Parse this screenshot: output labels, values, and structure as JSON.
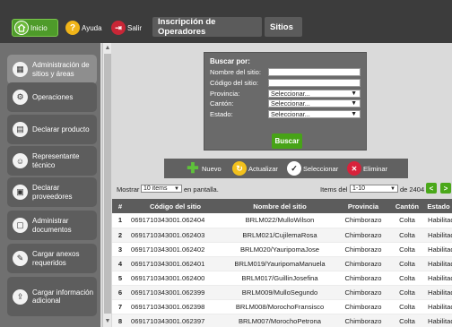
{
  "topbar": {
    "inicio_label": "Inicio",
    "ayuda_label": "Ayuda",
    "salir_label": "Salir",
    "tabs": [
      {
        "label": "Inscripción de Operadores"
      },
      {
        "label": "Sitios"
      }
    ],
    "accent": "#4e9b2a"
  },
  "sidebar": {
    "items": [
      {
        "label": "Administración de sitios y áreas",
        "icon": "building-icon"
      },
      {
        "label": "Operaciones",
        "icon": "gear-icon"
      },
      {
        "label": "Declarar producto",
        "icon": "truck-icon"
      },
      {
        "label": "Representante técnico",
        "icon": "person-icon"
      },
      {
        "label": "Declarar proveedores",
        "icon": "document-icon"
      },
      {
        "label": "Administrar documentos",
        "icon": "file-icon"
      },
      {
        "label": "Cargar anexos requeridos",
        "icon": "attachment-icon"
      },
      {
        "label": "Cargar información adicional",
        "icon": "upload-icon"
      }
    ]
  },
  "search": {
    "title": "Buscar por:",
    "fields": [
      {
        "label": "Nombre del sitio:",
        "value": ""
      },
      {
        "label": "Código del sitio:",
        "value": ""
      },
      {
        "label": "Provincia:",
        "value": "Seleccionar..."
      },
      {
        "label": "Cantón:",
        "value": "Seleccionar..."
      },
      {
        "label": "Estado:",
        "value": "Seleccionar..."
      }
    ],
    "button_label": "Buscar"
  },
  "toolbar": {
    "nuevo": "Nuevo",
    "actualizar": "Actualizar",
    "seleccionar": "Seleccionar",
    "eliminar": "Eliminar"
  },
  "pager": {
    "mostrar": "Mostrar",
    "items_per_page": "10 items",
    "en_pantalla": "en pantalla.",
    "items_del": "Items del",
    "range": "1-10",
    "of_total": "de 2404",
    "prev": "<",
    "next": ">"
  },
  "table": {
    "columns": [
      "#",
      "Código del sitio",
      "Nombre del sitio",
      "Provincia",
      "Cantón",
      "Estado"
    ],
    "rows": [
      [
        "1",
        "0691710343001.062404",
        "BRLM022/MulloWilson",
        "Chimborazo",
        "Colta",
        "Habilitado"
      ],
      [
        "2",
        "0691710343001.062403",
        "BRLM021/CujilemaRosa",
        "Chimborazo",
        "Colta",
        "Habilitado"
      ],
      [
        "3",
        "0691710343001.062402",
        "BRLM020/YauripomaJose",
        "Chimborazo",
        "Colta",
        "Habilitado"
      ],
      [
        "4",
        "0691710343001.062401",
        "BRLM019/YauripomaManuela",
        "Chimborazo",
        "Colta",
        "Habilitado"
      ],
      [
        "5",
        "0691710343001.062400",
        "BRLM017/GuillinJosefina",
        "Chimborazo",
        "Colta",
        "Habilitado"
      ],
      [
        "6",
        "0691710343001.062399",
        "BRLM009/MulloSegundo",
        "Chimborazo",
        "Colta",
        "Habilitado"
      ],
      [
        "7",
        "0691710343001.062398",
        "BRLM008/MorochoFransisco",
        "Chimborazo",
        "Colta",
        "Habilitado"
      ],
      [
        "8",
        "0691710343001.062397",
        "BRLM007/MorochoPetrona",
        "Chimborazo",
        "Colta",
        "Habilitado"
      ]
    ]
  }
}
